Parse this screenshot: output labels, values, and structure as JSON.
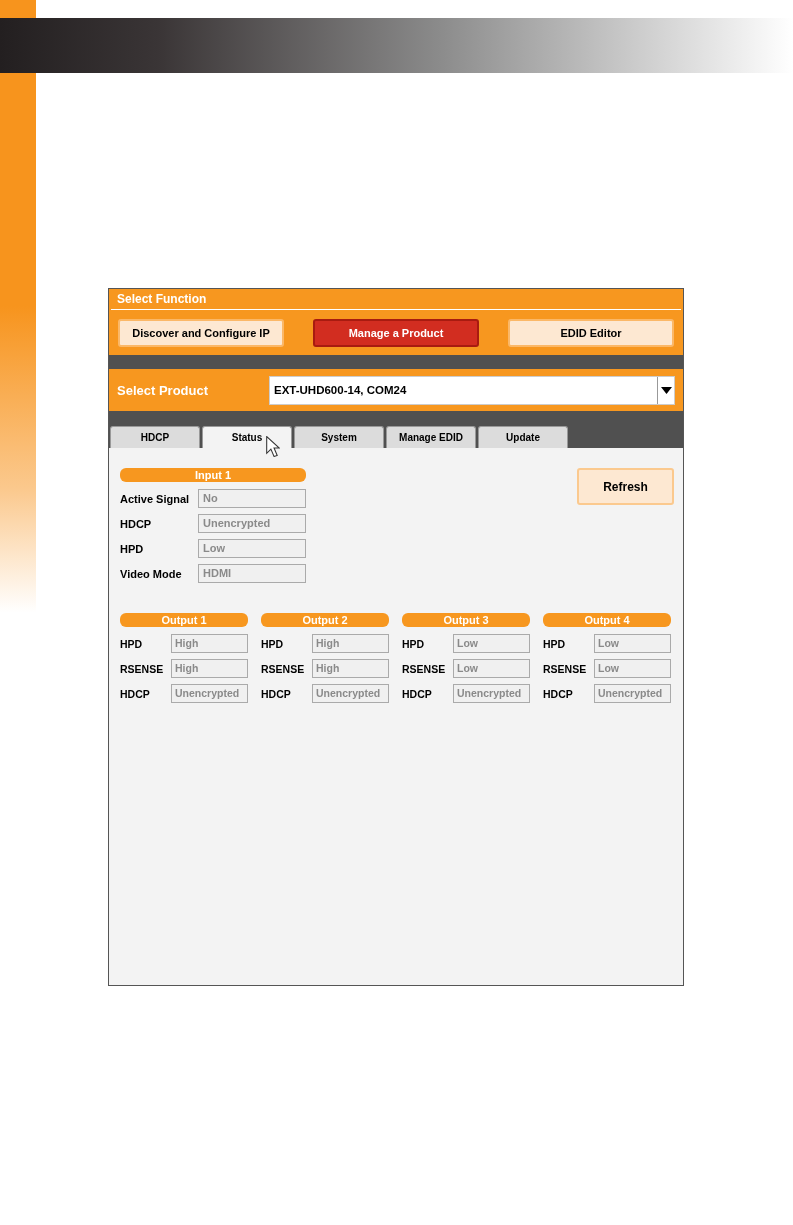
{
  "select_function": {
    "title": "Select Function",
    "buttons": [
      {
        "label": "Discover and Configure IP",
        "selected": false
      },
      {
        "label": "Manage a Product",
        "selected": true
      },
      {
        "label": "EDID Editor",
        "selected": false
      }
    ]
  },
  "select_product": {
    "label": "Select Product",
    "value": "EXT-UHD600-14, COM24"
  },
  "tabs": [
    {
      "label": "HDCP",
      "selected": false
    },
    {
      "label": "Status",
      "selected": true
    },
    {
      "label": "System",
      "selected": false
    },
    {
      "label": "Manage EDID",
      "selected": false
    },
    {
      "label": "Update",
      "selected": false
    }
  ],
  "refresh_button": "Refresh",
  "input": {
    "title": "Input 1",
    "fields": [
      {
        "label": "Active Signal",
        "value": "No"
      },
      {
        "label": "HDCP",
        "value": "Unencrypted"
      },
      {
        "label": "HPD",
        "value": "Low"
      },
      {
        "label": "Video Mode",
        "value": "HDMI"
      }
    ]
  },
  "outputs": [
    {
      "title": "Output 1",
      "fields": [
        {
          "label": "HPD",
          "value": "High"
        },
        {
          "label": "RSENSE",
          "value": "High"
        },
        {
          "label": "HDCP",
          "value": "Unencrypted"
        }
      ]
    },
    {
      "title": "Output 2",
      "fields": [
        {
          "label": "HPD",
          "value": "High"
        },
        {
          "label": "RSENSE",
          "value": "High"
        },
        {
          "label": "HDCP",
          "value": "Unencrypted"
        }
      ]
    },
    {
      "title": "Output 3",
      "fields": [
        {
          "label": "HPD",
          "value": "Low"
        },
        {
          "label": "RSENSE",
          "value": "Low"
        },
        {
          "label": "HDCP",
          "value": "Unencrypted"
        }
      ]
    },
    {
      "title": "Output 4",
      "fields": [
        {
          "label": "HPD",
          "value": "Low"
        },
        {
          "label": "RSENSE",
          "value": "Low"
        },
        {
          "label": "HDCP",
          "value": "Unencrypted"
        }
      ]
    }
  ]
}
